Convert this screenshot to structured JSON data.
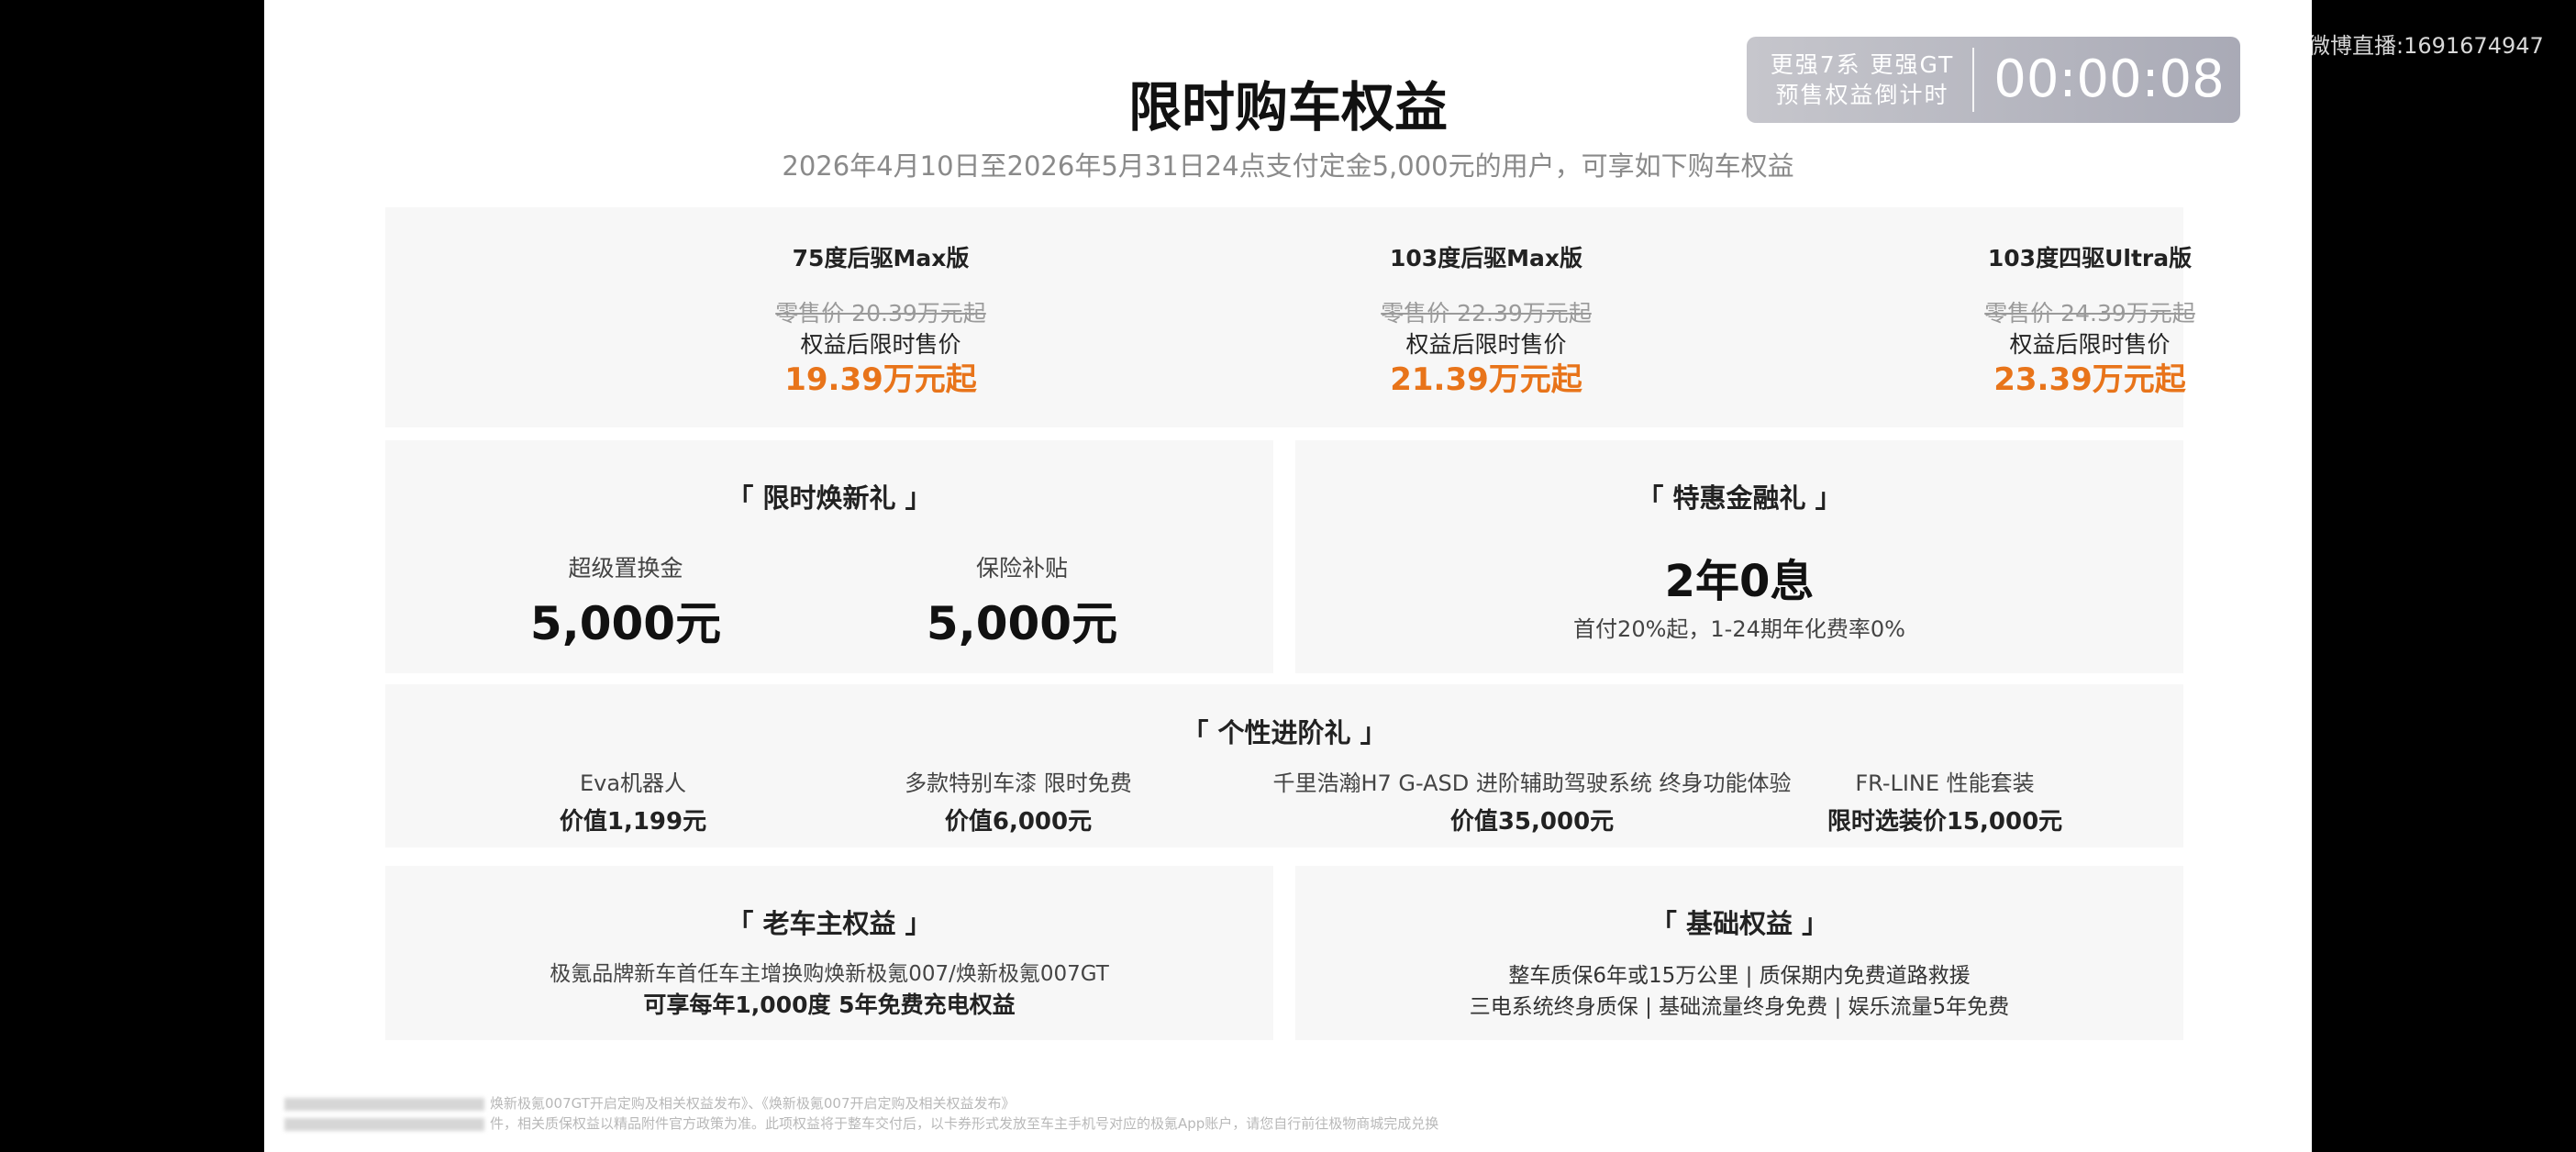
{
  "watermark": "微博直播:1691674947",
  "title": "限时购车权益",
  "subtitle": "2026年4月10日至2026年5月31日24点支付定金5,000元的用户，可享如下购车权益",
  "countdown": {
    "line1": "更强7系 更强GT",
    "line2": "预售权益倒计时",
    "time": "00:00:08"
  },
  "trims": [
    {
      "name": "75度后驱Max版",
      "original_price": "零售价 20.39万元起",
      "limit_label": "权益后限时售价",
      "limit_price": "19.39万元起"
    },
    {
      "name": "103度后驱Max版",
      "original_price": "零售价 22.39万元起",
      "limit_label": "权益后限时售价",
      "limit_price": "21.39万元起"
    },
    {
      "name": "103度四驱Ultra版",
      "original_price": "零售价 24.39万元起",
      "limit_label": "权益后限时售价",
      "limit_price": "23.39万元起"
    }
  ],
  "renewal_gift": {
    "title": "「 限时焕新礼 」",
    "items": [
      {
        "label": "超级置换金",
        "value": "5,000元"
      },
      {
        "label": "保险补贴",
        "value": "5,000元"
      }
    ]
  },
  "finance_gift": {
    "title": "「 特惠金融礼 」",
    "headline": "2年0息",
    "note": "首付20%起，1-24期年化费率0%"
  },
  "personal_gift": {
    "title": "「 个性进阶礼 」",
    "items": [
      {
        "label": "Eva机器人",
        "value": "价值1,199元"
      },
      {
        "label": "多款特别车漆 限时免费",
        "value": "价值6,000元"
      },
      {
        "label": "千里浩瀚H7 G-ASD 进阶辅助驾驶系统 终身功能体验",
        "value": "价值35,000元"
      },
      {
        "label": "FR-LINE 性能套装",
        "value": "限时选装价15,000元"
      }
    ]
  },
  "owner_rights": {
    "title": "「 老车主权益 」",
    "line1": "极氪品牌新车首任车主增换购焕新极氪007/焕新极氪007GT",
    "line2": "可享每年1,000度 5年免费充电权益"
  },
  "basic_rights": {
    "title": "「 基础权益 」",
    "line1": "整车质保6年或15万公里 | 质保期内免费道路救援",
    "line2": "三电系统终身质保 | 基础流量终身免费 | 娱乐流量5年免费"
  },
  "footnotes": {
    "line1": "焕新极氪007GT开启定购及相关权益发布》、《焕新极氪007开启定购及相关权益发布》",
    "line2": "件，相关质保权益以精品附件官方政策为准。此项权益将于整车交付后，以卡券形式发放至车主手机号对应的极氪App账户，请您自行前往极物商城完成兑换"
  }
}
